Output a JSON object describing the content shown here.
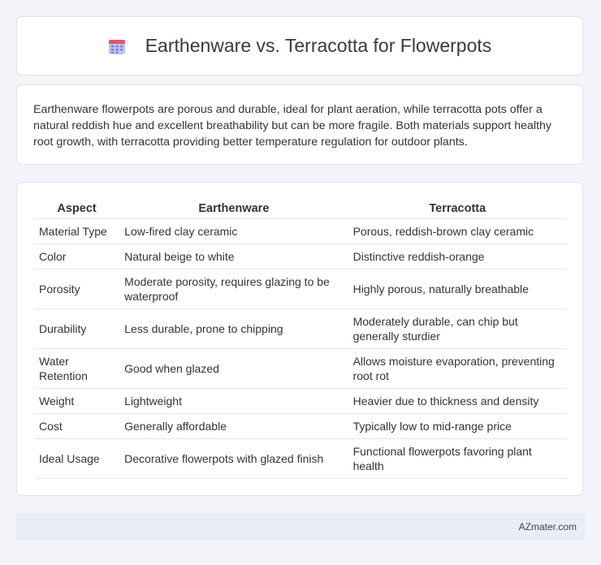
{
  "header": {
    "title": "Earthenware vs. Terracotta for Flowerpots",
    "icon": "calendar-grid-icon",
    "icon_colors": {
      "top": "#e4566e",
      "body": "#b9c3f0",
      "dots": "#6f7fd6"
    }
  },
  "summary": {
    "text": "Earthenware flowerpots are porous and durable, ideal for plant aeration, while terracotta pots offer a natural reddish hue and excellent breathability but can be more fragile. Both materials support healthy root growth, with terracotta providing better temperature regulation for outdoor plants."
  },
  "table": {
    "headers": [
      "Aspect",
      "Earthenware",
      "Terracotta"
    ],
    "rows": [
      [
        "Material Type",
        "Low-fired clay ceramic",
        "Porous, reddish-brown clay ceramic"
      ],
      [
        "Color",
        "Natural beige to white",
        "Distinctive reddish-orange"
      ],
      [
        "Porosity",
        "Moderate porosity, requires glazing to be waterproof",
        "Highly porous, naturally breathable"
      ],
      [
        "Durability",
        "Less durable, prone to chipping",
        "Moderately durable, can chip but generally sturdier"
      ],
      [
        "Water Retention",
        "Good when glazed",
        "Allows moisture evaporation, preventing root rot"
      ],
      [
        "Weight",
        "Lightweight",
        "Heavier due to thickness and density"
      ],
      [
        "Cost",
        "Generally affordable",
        "Typically low to mid-range price"
      ],
      [
        "Ideal Usage",
        "Decorative flowerpots with glazed finish",
        "Functional flowerpots favoring plant health"
      ]
    ]
  },
  "footer": {
    "brand": "AZmater.com"
  }
}
